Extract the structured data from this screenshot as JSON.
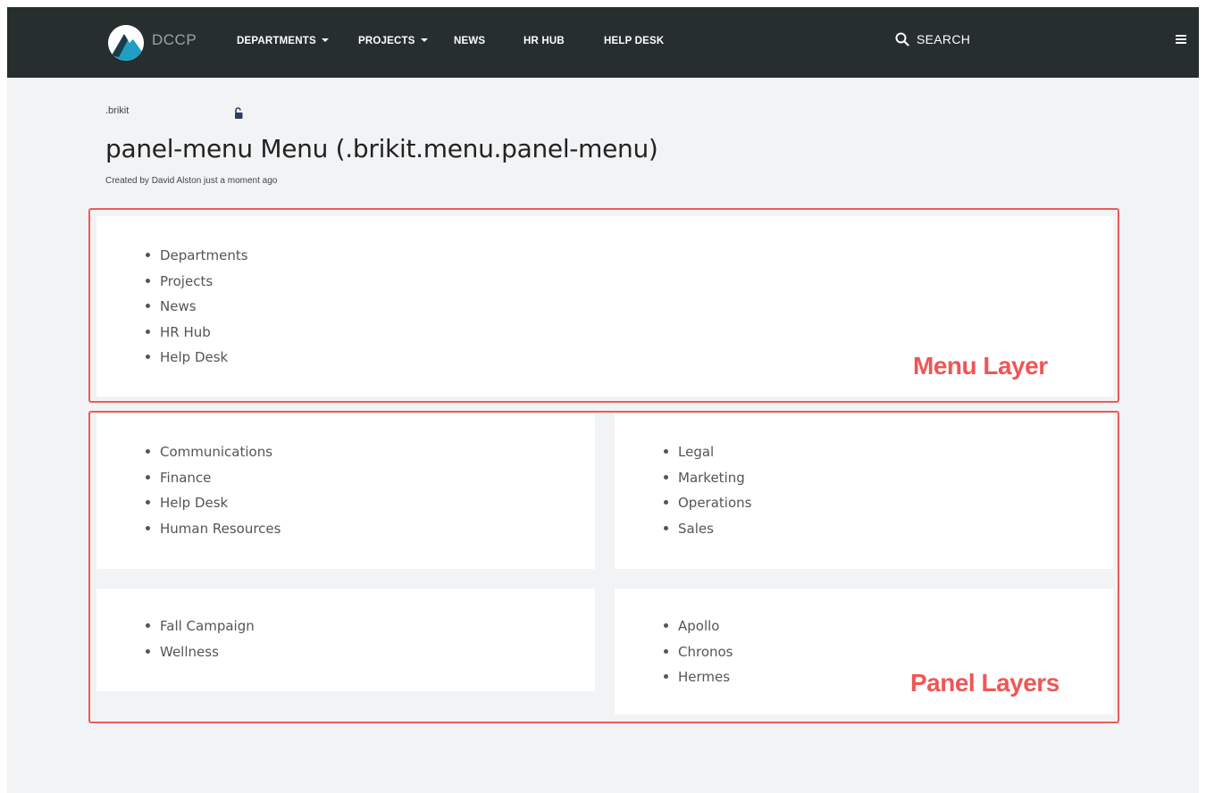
{
  "brand": {
    "name": "DCCP"
  },
  "nav": {
    "departments": "DEPARTMENTS",
    "projects": "PROJECTS",
    "news": "NEWS",
    "hr_hub": "HR HUB",
    "help_desk": "HELP DESK",
    "search": "SEARCH"
  },
  "icons": {
    "logo": "mountain-logo-icon",
    "search": "search-icon",
    "menu": "hamburger-menu-icon",
    "lock": "unlocked-padlock-icon"
  },
  "page": {
    "breadcrumb": ".brikit",
    "title": "panel-menu Menu (.brikit.menu.panel-menu)",
    "byline": "Created by David Alston just a moment ago"
  },
  "menu_layer": {
    "items": [
      "Departments",
      "Projects",
      "News",
      "HR Hub",
      "Help Desk"
    ]
  },
  "panels": {
    "top_left": [
      "Communications",
      "Finance",
      "Help Desk",
      "Human Resources"
    ],
    "top_right": [
      "Legal",
      "Marketing",
      "Operations",
      "Sales"
    ],
    "bottom_left": [
      "Fall Campaign",
      "Wellness"
    ],
    "bottom_right": [
      "Apollo",
      "Chronos",
      "Hermes"
    ]
  },
  "annotations": {
    "menu_layer": "Menu Layer",
    "panel_layers": "Panel Layers",
    "color": "#ef5656"
  }
}
